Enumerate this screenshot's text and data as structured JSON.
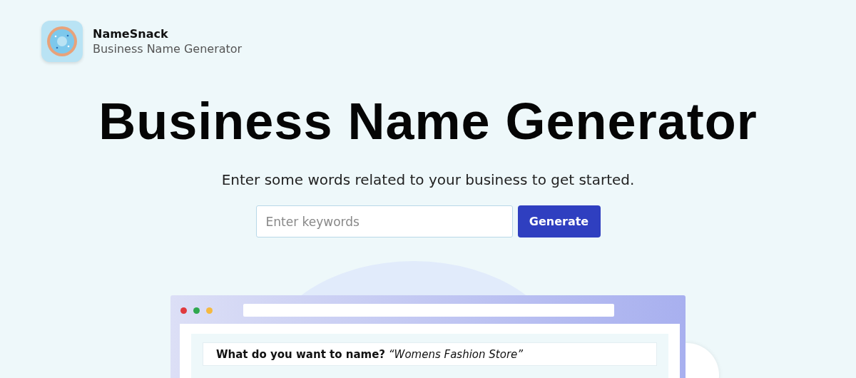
{
  "brand": {
    "name": "NameSnack",
    "tagline": "Business Name Generator"
  },
  "hero": {
    "title": "Business Name Generator",
    "subtitle": "Enter some words related to your business to get started."
  },
  "search": {
    "placeholder": "Enter keywords",
    "button": "Generate"
  },
  "preview": {
    "dots": [
      {
        "color": "#e0393e"
      },
      {
        "color": "#2fa84f"
      },
      {
        "color": "#f5b940"
      }
    ],
    "question": "**What do you want to name?** *“Womens Fashion Store”*"
  }
}
